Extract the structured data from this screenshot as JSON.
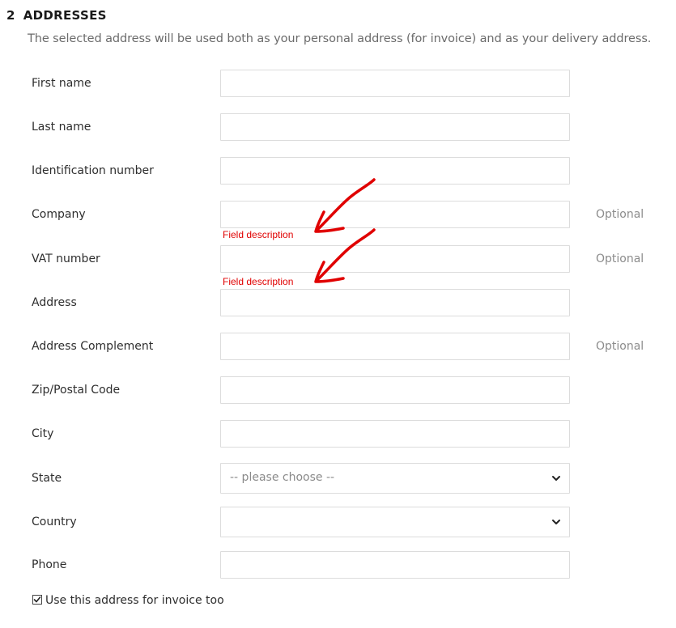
{
  "section": {
    "number": "2",
    "title": "ADDRESSES",
    "intro": "The selected address will be used both as your personal address (for invoice) and as your delivery address."
  },
  "fields": [
    {
      "label": "First name",
      "value": "",
      "optional": ""
    },
    {
      "label": "Last name",
      "value": "",
      "optional": ""
    },
    {
      "label": "Identification number",
      "value": "",
      "optional": ""
    },
    {
      "label": "Company",
      "value": "",
      "optional": "Optional",
      "description": "Field description"
    },
    {
      "label": "VAT number",
      "value": "",
      "optional": "Optional",
      "description": "Field description"
    },
    {
      "label": "Address",
      "value": "",
      "optional": ""
    },
    {
      "label": "Address Complement",
      "value": "",
      "optional": "Optional"
    },
    {
      "label": "Zip/Postal Code",
      "value": "",
      "optional": ""
    },
    {
      "label": "City",
      "value": "",
      "optional": ""
    },
    {
      "label": "State",
      "type": "select",
      "selected": "-- please choose --"
    },
    {
      "label": "Country",
      "type": "select",
      "selected": ""
    },
    {
      "label": "Phone",
      "value": "",
      "optional": ""
    }
  ],
  "invoice_checkbox": {
    "label": "Use this address for invoice too",
    "checked": true
  },
  "annotation_color": "#e00000",
  "icons": {
    "select": "chevron-down-icon",
    "annotation": "red-arrow-icon"
  }
}
